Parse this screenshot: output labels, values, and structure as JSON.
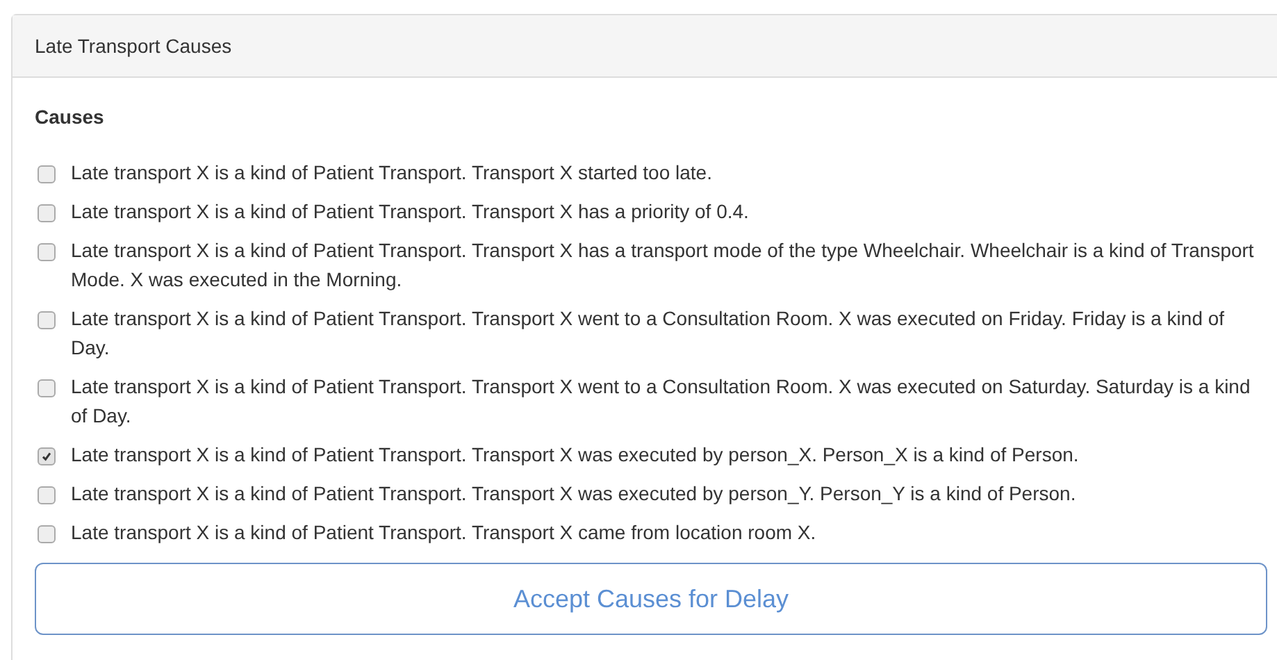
{
  "panel": {
    "title": "Late Transport Causes"
  },
  "section": {
    "heading": "Causes"
  },
  "causes": [
    {
      "text": "Late transport X is a kind of Patient Transport. Transport X started too late.",
      "checked": false
    },
    {
      "text": "Late transport X is a kind of Patient Transport. Transport X has a priority of 0.4.",
      "checked": false
    },
    {
      "text": "Late transport X is a kind of Patient Transport. Transport X has a transport mode of the type Wheelchair. Wheelchair is a kind of Transport Mode. X was executed in the Morning.",
      "checked": false
    },
    {
      "text": "Late transport X is a kind of Patient Transport. Transport X went to a Consultation Room. X was executed on Friday. Friday is a kind of Day.",
      "checked": false
    },
    {
      "text": "Late transport X is a kind of Patient Transport. Transport X went to a Consultation Room. X was executed on Saturday. Saturday is a kind of Day.",
      "checked": false
    },
    {
      "text": "Late transport X is a kind of Patient Transport. Transport X was executed by person_X. Person_X is a kind of Person.",
      "checked": true
    },
    {
      "text": "Late transport X is a kind of Patient Transport. Transport X was executed by person_Y. Person_Y is a kind of Person.",
      "checked": false
    },
    {
      "text": "Late transport X is a kind of Patient Transport. Transport X came from location room X.",
      "checked": false
    }
  ],
  "button": {
    "label": "Accept Causes for Delay"
  }
}
